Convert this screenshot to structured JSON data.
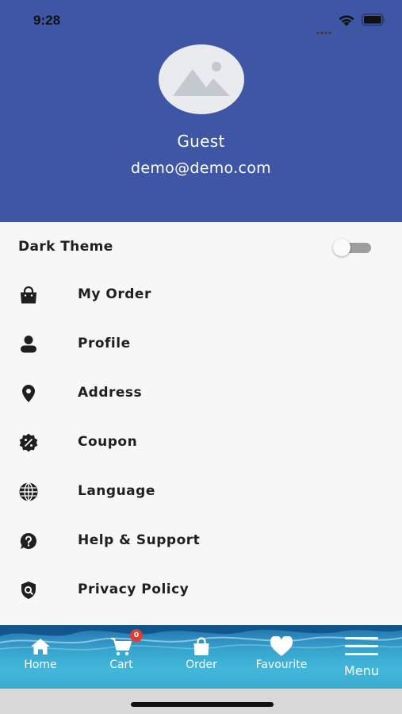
{
  "status_bar": {
    "time": "9:28"
  },
  "profile": {
    "name": "Guest",
    "email": "demo@demo.com"
  },
  "dark_theme": {
    "label": "Dark Theme",
    "enabled": false
  },
  "menu": [
    {
      "label": "My Order",
      "icon": "shopping-bag-icon"
    },
    {
      "label": "Profile",
      "icon": "person-icon"
    },
    {
      "label": "Address",
      "icon": "location-pin-icon"
    },
    {
      "label": "Coupon",
      "icon": "coupon-percent-icon"
    },
    {
      "label": "Language",
      "icon": "globe-icon"
    },
    {
      "label": "Help & Support",
      "icon": "help-question-icon"
    },
    {
      "label": "Privacy Policy",
      "icon": "privacy-shield-icon"
    }
  ],
  "bottom_nav": {
    "home": "Home",
    "cart": "Cart",
    "cart_badge": "0",
    "order": "Order",
    "favourite": "Favourite",
    "menu": "Menu"
  },
  "colors": {
    "header": "#3e56a4",
    "nav_water": "#37a5cf",
    "badge": "#e53935"
  }
}
